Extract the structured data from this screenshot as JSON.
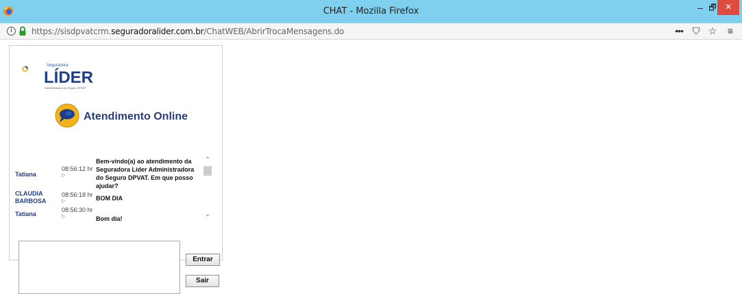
{
  "window": {
    "title": "CHAT - Mozilla Firefox",
    "minimize": "–",
    "maximize": "🗗",
    "close": "✕"
  },
  "urlbar": {
    "info": "i",
    "url_prefix": "https://sisdpvatcrm.",
    "url_domain": "seguradoralider.com.br",
    "url_path": "/ChatWEB/AbrirTrocaMensagens.do",
    "more": "•••",
    "pocket": "⛉",
    "star": "☆",
    "menu": "≡"
  },
  "brand": {
    "small": "Seguradora",
    "main": "LÍDER",
    "sub": "Administradora do Seguro DPVAT"
  },
  "chat": {
    "title": "Atendimento Online",
    "messages": [
      {
        "sender": "Tatiana",
        "time": "08:56:12 hr",
        "text": "Bem-vindo(a) ao atendimento da Seguradora Líder Administradora do Seguro DPVAT. Em que posso ajudar?"
      },
      {
        "sender": "CLAUDIA BARBOSA",
        "time": "08:56:18 hr",
        "text": "BOM DIA"
      },
      {
        "sender": "Tatiana",
        "time": "08:56:30 hr",
        "text": "Bom dia!"
      }
    ],
    "arrow": "▷",
    "scroll_up": "⌃",
    "scroll_down": "⌄"
  },
  "controls": {
    "input_value": "",
    "enter_label": "Entrar",
    "exit_label": "Sair"
  },
  "colors": {
    "titlebar": "#7ed0ee",
    "close": "#e04a3f",
    "brand_blue": "#1d3f8a",
    "brand_yellow": "#f2b419"
  }
}
